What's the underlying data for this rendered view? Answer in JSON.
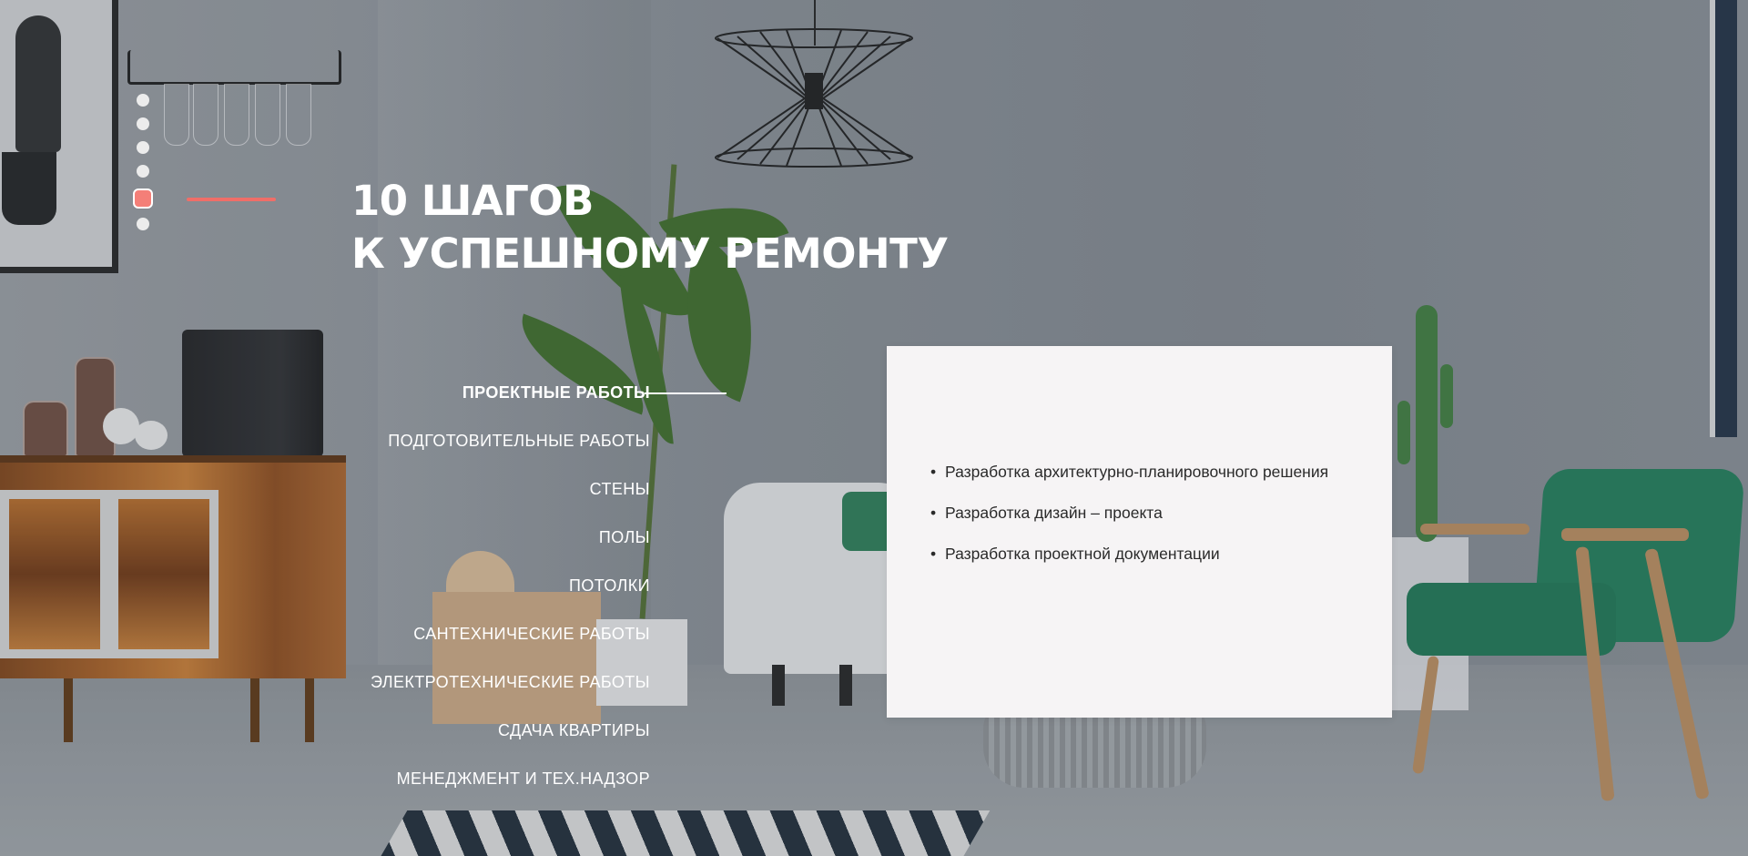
{
  "slider": {
    "dot_count": 6,
    "active_index": 4
  },
  "headline": {
    "line1": "10 ШАГОВ",
    "line2": "К УСПЕШНОМУ РЕМОНТУ"
  },
  "steps": [
    "ПРОЕКТНЫЕ РАБОТЫ",
    "ПОДГОТОВИТЕЛЬНЫЕ РАБОТЫ",
    "СТЕНЫ",
    "ПОЛЫ",
    "ПОТОЛКИ",
    "САНТЕХНИЧЕСКИЕ РАБОТЫ",
    "ЭЛЕКТРОТЕХНИЧЕСКИЕ РАБОТЫ",
    "СДАЧА КВАРТИРЫ",
    "МЕНЕДЖМЕНТ И ТЕХ.НАДЗОР"
  ],
  "active_step_index": 0,
  "details": {
    "items": [
      "Разработка архитектурно-планировочного решения",
      "Разработка дизайн – проекта",
      "Разработка проектной документации"
    ]
  },
  "colors": {
    "accent": "#f06e68",
    "card_bg": "#f6f4f5",
    "text_light": "#ffffff",
    "text_dark": "#2a2a2a"
  }
}
